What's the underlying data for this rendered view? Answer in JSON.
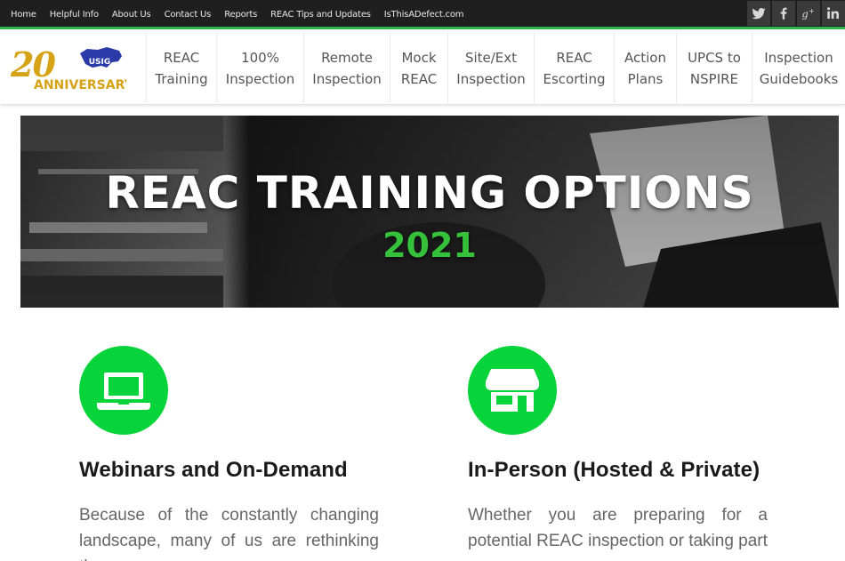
{
  "topbar": {
    "links": [
      "Home",
      "Helpful Info",
      "About Us",
      "Contact Us",
      "Reports",
      "REAC Tips and Updates",
      "IsThisADefect.com"
    ],
    "social": [
      "twitter-icon",
      "facebook-icon",
      "google-plus-icon",
      "linkedin-icon"
    ]
  },
  "logo": {
    "number": "20",
    "badge": "USIG",
    "text": "ANNIVERSARY"
  },
  "nav": {
    "items": [
      {
        "line1": "REAC",
        "line2": "Training"
      },
      {
        "line1": "100%",
        "line2": "Inspection"
      },
      {
        "line1": "Remote",
        "line2": "Inspection"
      },
      {
        "line1": "Mock",
        "line2": "REAC"
      },
      {
        "line1": "Site/Ext",
        "line2": "Inspection"
      },
      {
        "line1": "REAC",
        "line2": "Escorting"
      },
      {
        "line1": "Action",
        "line2": "Plans"
      },
      {
        "line1": "UPCS to",
        "line2": "NSPIRE"
      },
      {
        "line1": "Inspection",
        "line2": "Guidebooks"
      }
    ]
  },
  "hero": {
    "title": "REAC TRAINING OPTIONS",
    "year": "2021"
  },
  "features": {
    "left": {
      "icon": "laptop-icon",
      "title": "Webinars and On-Demand",
      "text": "Because of the constantly changing landscape, many of us are rethinking the"
    },
    "right": {
      "icon": "storefront-icon",
      "title": "In-Person (Hosted & Private)",
      "text": "Whether you are preparing for a potential REAC inspection or taking part"
    }
  },
  "colors": {
    "accent_green": "#07d33a",
    "topbar_bg": "#1f1f1f",
    "logo_gold": "#d6a317",
    "logo_blue": "#2a3aa8"
  }
}
